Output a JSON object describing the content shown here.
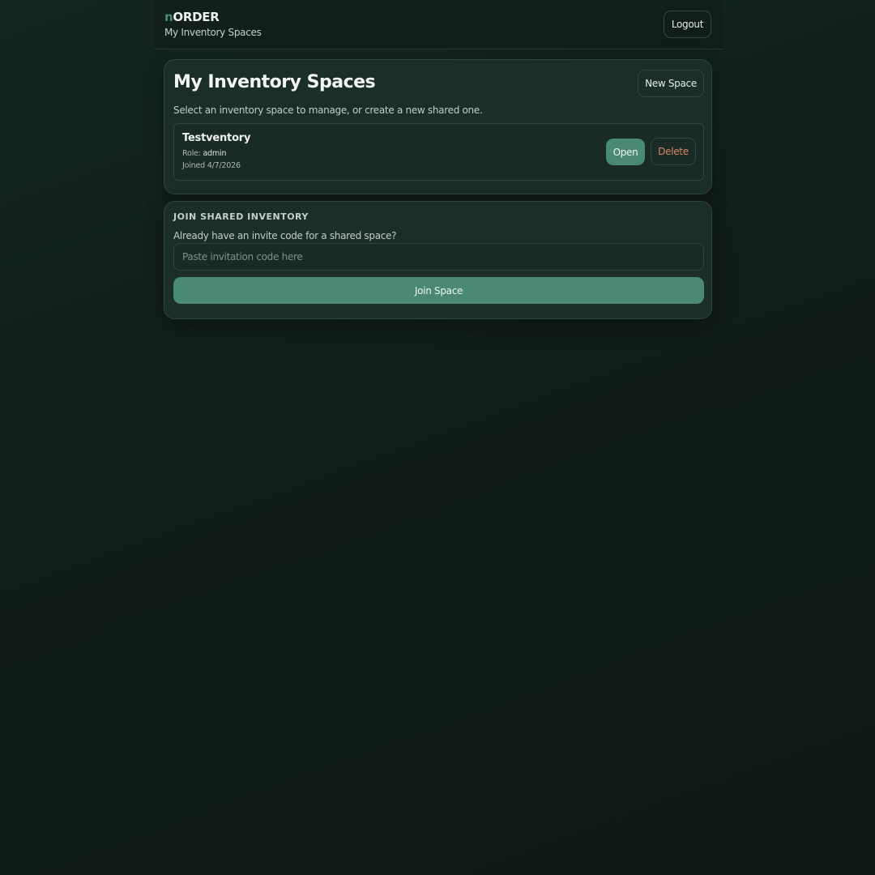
{
  "header": {
    "brand_accent": "n",
    "brand_rest": "ORDER",
    "subtitle": "My Inventory Spaces",
    "logout_label": "Logout"
  },
  "spaces_card": {
    "title": "My Inventory Spaces",
    "new_space_label": "New Space",
    "description": "Select an inventory space to manage, or create a new shared one.",
    "items": [
      {
        "name": "Testventory",
        "role_label": "Role:",
        "role": "admin",
        "joined": "Joined 4/7/2026",
        "open_label": "Open",
        "delete_label": "Delete"
      }
    ]
  },
  "join_card": {
    "heading": "JOIN SHARED INVENTORY",
    "description": "Already have an invite code for a shared space?",
    "input_value": "",
    "input_placeholder": "Paste invitation code here",
    "join_label": "Join Space"
  },
  "colors": {
    "background": "#111d19",
    "card": "#1c2e28",
    "accent": "#4a8a73",
    "danger_text": "#d9876b"
  }
}
